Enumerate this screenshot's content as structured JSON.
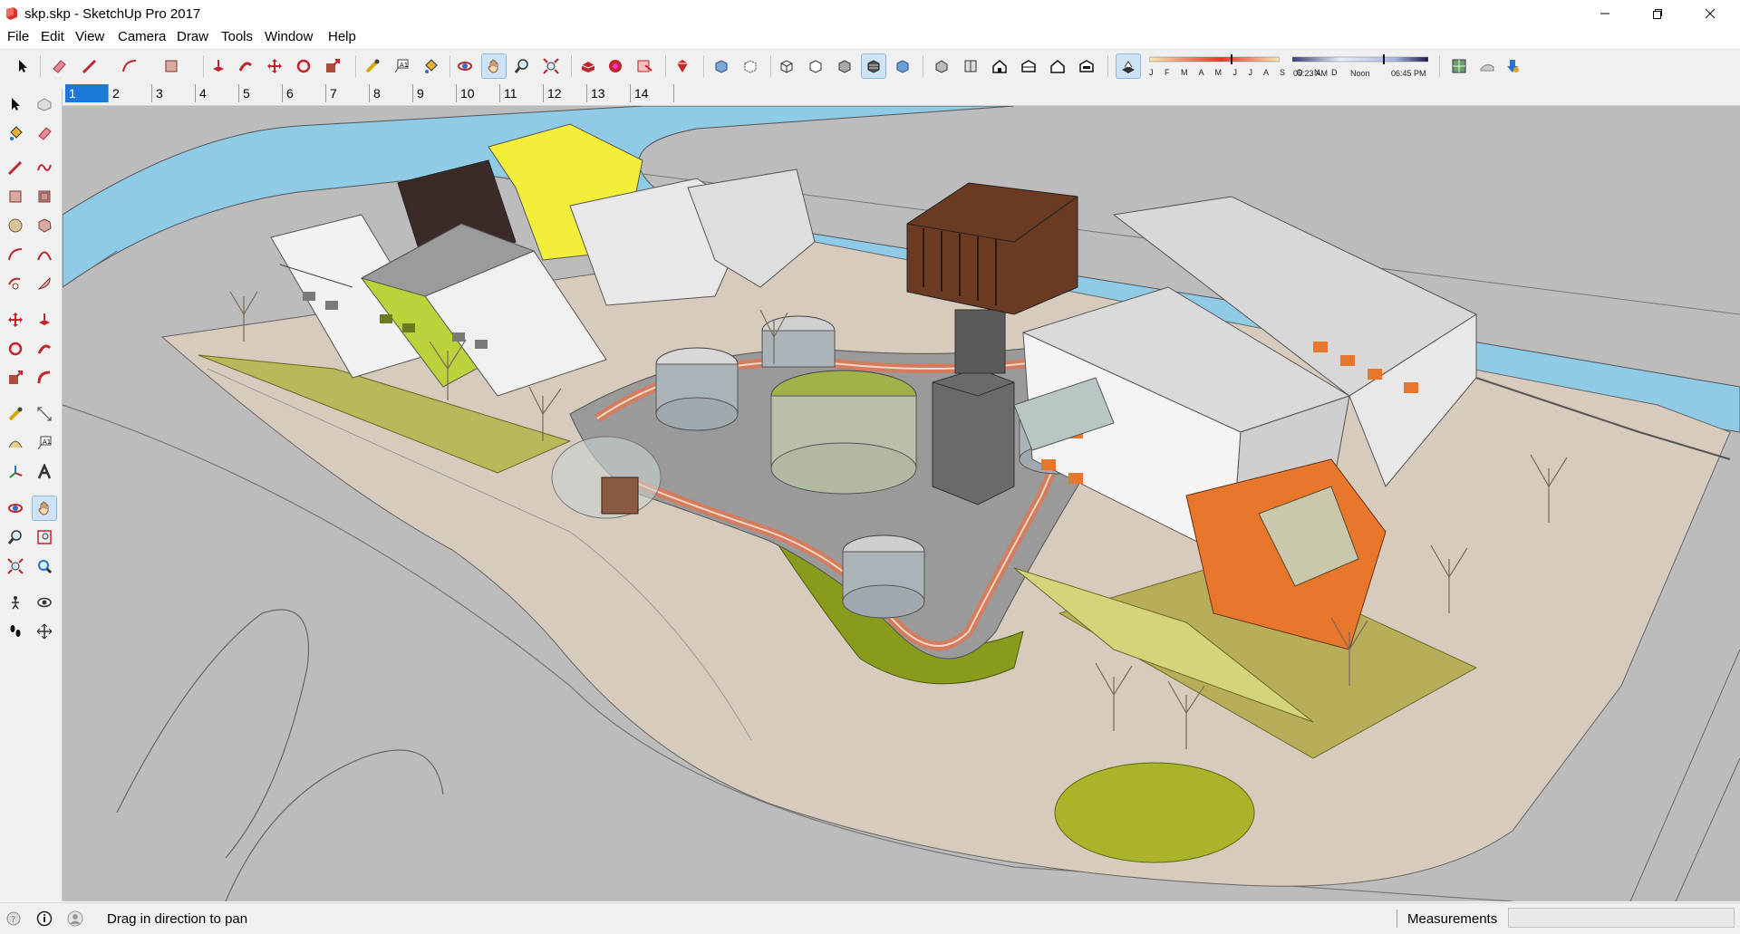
{
  "window": {
    "title": "skp.skp - SketchUp Pro 2017",
    "controls": [
      "minimize",
      "restore",
      "close"
    ]
  },
  "menu": [
    "File",
    "Edit",
    "View",
    "Camera",
    "Draw",
    "Tools",
    "Window",
    "Help"
  ],
  "toolbar": {
    "icons": [
      "select-icon",
      "eraser-icon",
      "line-icon",
      "arc-icon",
      "rectangle-icon",
      "push-pull-icon",
      "follow-me-icon",
      "move-icon",
      "rotate-icon",
      "scale-icon",
      "tape-measure-icon",
      "text-icon",
      "paint-bucket-icon",
      "orbit-icon",
      "pan-icon",
      "zoom-icon",
      "zoom-extents-icon",
      "warehouse-icon",
      "extension-warehouse-icon",
      "layout-icon",
      "ruby-icon",
      "xray-icon",
      "back-edges-icon",
      "wireframe-icon",
      "hidden-line-icon",
      "shaded-icon",
      "shaded-textures-icon",
      "monochrome-icon",
      "iso-view-icon",
      "top-view-icon",
      "front-view-icon",
      "right-view-icon",
      "back-view-icon",
      "left-view-icon",
      "shadows-toggle-icon"
    ],
    "shadow_months": "J F M A M J J A S O N D",
    "shadow_time_start": "05:23 AM",
    "shadow_time_mid": "Noon",
    "shadow_time_end": "06:45 PM",
    "right_icons": [
      "geo-location-icon",
      "sandbox-icon",
      "add-location-icon"
    ]
  },
  "scenes": [
    "1",
    "2",
    "3",
    "4",
    "5",
    "6",
    "7",
    "8",
    "9",
    "10",
    "11",
    "12",
    "13",
    "14"
  ],
  "active_scene": "1",
  "status": {
    "hint": "Drag in direction to pan",
    "measurements_label": "Measurements",
    "measurements_value": ""
  },
  "colors": {
    "accent": "#1e78d7",
    "water": "#8fcbe6",
    "ground": "#bdbdbd",
    "lime": "#a8c032",
    "orange": "#e8762b",
    "yellow": "#f0e43a",
    "white_facade": "#f2f2f2"
  }
}
